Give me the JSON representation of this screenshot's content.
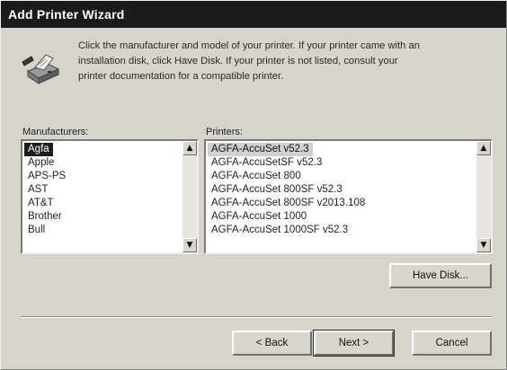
{
  "window": {
    "title": "Add Printer Wizard"
  },
  "header": {
    "instructions": "Click the manufacturer and model of your printer. If your printer came with an\ninstallation disk, click Have Disk. If your printer is not listed, consult your\nprinter documentation for a compatible printer.",
    "icon": "printer-icon"
  },
  "manufacturers": {
    "label": "Manufacturers:",
    "items": [
      "Agfa",
      "Apple",
      "APS-PS",
      "AST",
      "AT&T",
      "Brother",
      "Bull"
    ],
    "selected": "Agfa"
  },
  "printers": {
    "label": "Printers:",
    "items": [
      "AGFA-AccuSet v52.3",
      "AGFA-AccuSetSF v52.3",
      "AGFA-AccuSet 800",
      "AGFA-AccuSet 800SF v52.3",
      "AGFA-AccuSet 800SF v2013.108",
      "AGFA-AccuSet 1000",
      "AGFA-AccuSet 1000SF v52.3"
    ],
    "selected": "AGFA-AccuSet v52.3"
  },
  "buttons": {
    "have_disk": "Have Disk...",
    "back": "< Back",
    "next": "Next >",
    "cancel": "Cancel"
  },
  "colors": {
    "titlebar": "#1b1b1b",
    "face": "#d7d4cb",
    "selection": "#1d1d1d"
  }
}
